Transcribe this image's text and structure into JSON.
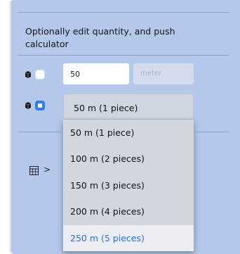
{
  "instruction": "Optionally edit quantity, and push calculator",
  "quantity": {
    "value": "50",
    "unit": "meter"
  },
  "select": {
    "selected": "50 m (1 piece)",
    "options": [
      "50 m (1 piece)",
      "100 m (2 pieces)",
      "150 m (3 pieces)",
      "200 m (4 pieces)",
      "250 m (5 pieces)"
    ],
    "highlighted_option": "250 m (5 pieces)"
  },
  "calculator_button": {
    "icon": "calculator-icon",
    "chevron": ">"
  },
  "icons": {
    "row_icon": "cube-icon"
  },
  "colors": {
    "panel_background": "#b3c8ea",
    "accent": "#2f7fe6",
    "highlight_text": "#2e6fd8"
  }
}
